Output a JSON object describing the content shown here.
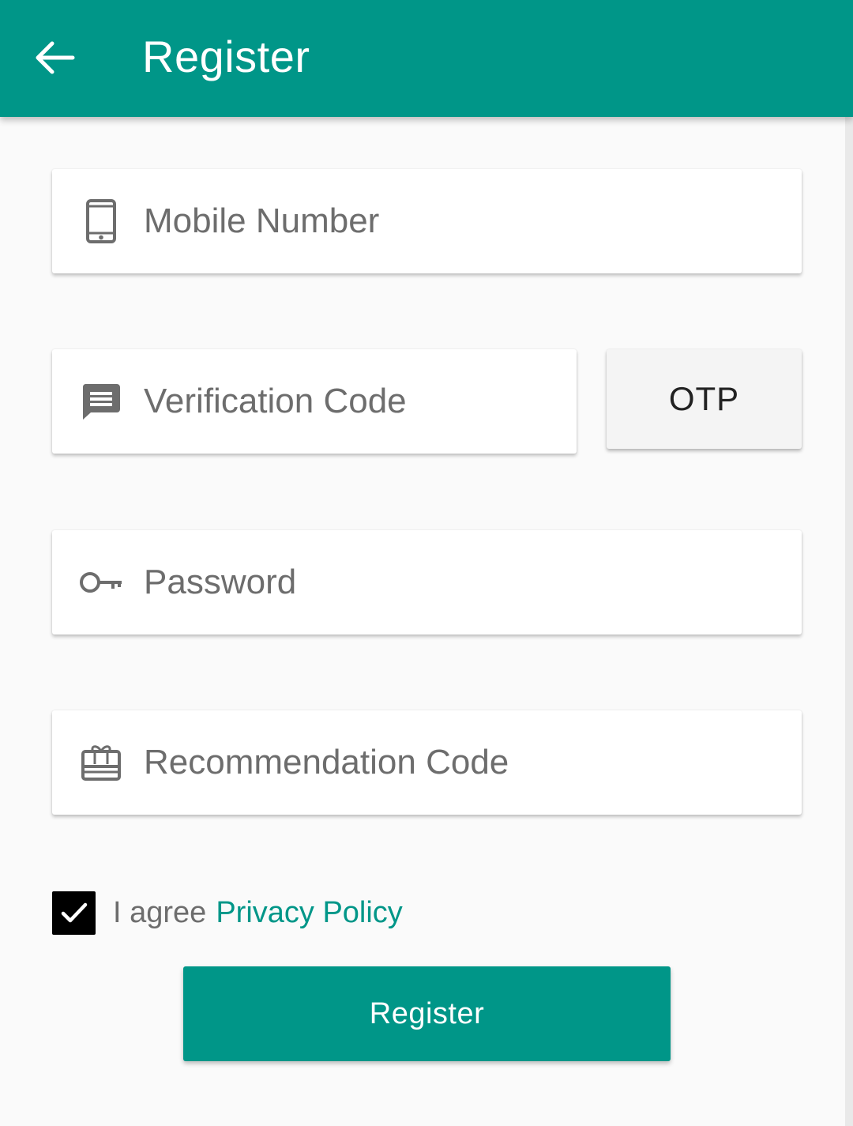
{
  "header": {
    "title": "Register",
    "back_icon": "arrow-left-icon",
    "color": "#009688"
  },
  "form": {
    "mobile": {
      "placeholder": "Mobile Number",
      "icon": "phone-icon"
    },
    "verification": {
      "placeholder": "Verification Code",
      "icon": "message-icon"
    },
    "otp_button": {
      "label": "OTP"
    },
    "password": {
      "placeholder": "Password",
      "icon": "key-icon"
    },
    "recommendation": {
      "placeholder": "Recommendation Code",
      "icon": "gift-card-icon"
    }
  },
  "agreement": {
    "checked": true,
    "text": "I agree",
    "link": "Privacy Policy",
    "link_color": "#009688"
  },
  "register_button": {
    "label": "Register",
    "color": "#009688"
  }
}
